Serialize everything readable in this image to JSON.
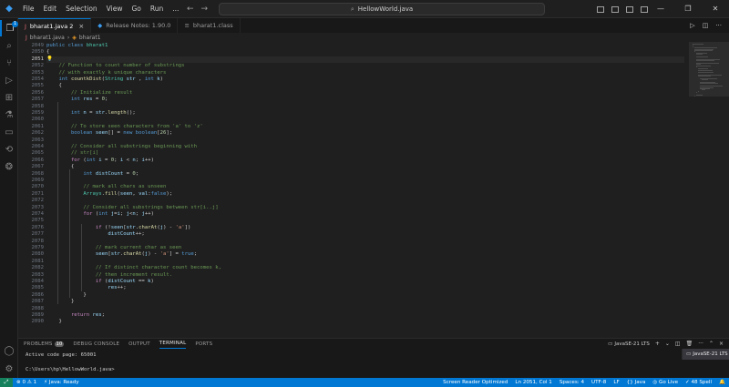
{
  "titlebar": {
    "menu": [
      "File",
      "Edit",
      "Selection",
      "View",
      "Go",
      "Run",
      "..."
    ],
    "search_text": "HellowWorld.java",
    "back_icon": "arrow-left-icon",
    "forward_icon": "arrow-right-icon"
  },
  "tabs": [
    {
      "label": "bharat1.java 2",
      "active": true
    },
    {
      "label": "Release Notes: 1.90.0",
      "active": false
    },
    {
      "label": "bharat1.class",
      "active": false
    }
  ],
  "breadcrumb": {
    "file": "bharat1.java",
    "symbol": "bharat1"
  },
  "editor": {
    "current_line": 2051,
    "lines": [
      {
        "n": 2049,
        "code": [
          [
            "kw",
            "public "
          ],
          [
            "kw",
            "class "
          ],
          [
            "ty",
            "bharat1"
          ]
        ]
      },
      {
        "n": 2050,
        "code": [
          [
            "",
            "{"
          ]
        ]
      },
      {
        "n": 2051,
        "code": [
          [
            "bulb",
            "💡"
          ]
        ]
      },
      {
        "n": 2052,
        "code": [
          [
            "cm",
            "    // Function to count number of substrings"
          ]
        ]
      },
      {
        "n": 2053,
        "code": [
          [
            "cm",
            "    // with exactly k unique characters"
          ]
        ]
      },
      {
        "n": 2054,
        "code": [
          [
            "kw",
            "    int "
          ],
          [
            "fn",
            "countkDist"
          ],
          [
            "",
            "("
          ],
          [
            "ty",
            "String "
          ],
          [
            "var",
            "str"
          ],
          [
            "",
            " , "
          ],
          [
            "kw",
            "int "
          ],
          [
            "var",
            "k"
          ],
          [
            "",
            ")"
          ]
        ]
      },
      {
        "n": 2055,
        "code": [
          [
            "",
            "    {"
          ]
        ]
      },
      {
        "n": 2056,
        "code": [
          [
            "cm",
            "        // Initialize result"
          ]
        ]
      },
      {
        "n": 2057,
        "code": [
          [
            "kw",
            "        int "
          ],
          [
            "var",
            "res"
          ],
          [
            "",
            " = "
          ],
          [
            "num",
            "0"
          ],
          [
            "",
            ";"
          ]
        ]
      },
      {
        "n": 2058,
        "code": [
          [
            "",
            ""
          ]
        ]
      },
      {
        "n": 2059,
        "code": [
          [
            "kw",
            "        int "
          ],
          [
            "var",
            "n"
          ],
          [
            "",
            " = "
          ],
          [
            "var",
            "str"
          ],
          [
            "",
            "."
          ],
          [
            "fn",
            "length"
          ],
          [
            "",
            "();"
          ]
        ]
      },
      {
        "n": 2060,
        "code": [
          [
            "",
            ""
          ]
        ]
      },
      {
        "n": 2061,
        "code": [
          [
            "cm",
            "        // To store seen characters from 'a' to 'z'"
          ]
        ]
      },
      {
        "n": 2062,
        "code": [
          [
            "kw",
            "        boolean "
          ],
          [
            "var",
            "seen"
          ],
          [
            "",
            "[] = "
          ],
          [
            "kw",
            "new "
          ],
          [
            "kw",
            "boolean"
          ],
          [
            "",
            "["
          ],
          [
            "num",
            "26"
          ],
          [
            "",
            "];"
          ]
        ]
      },
      {
        "n": 2063,
        "code": [
          [
            "",
            ""
          ]
        ]
      },
      {
        "n": 2064,
        "code": [
          [
            "cm",
            "        // Consider all substrings beginning with"
          ]
        ]
      },
      {
        "n": 2065,
        "code": [
          [
            "cm",
            "        // str[i]"
          ]
        ]
      },
      {
        "n": 2066,
        "code": [
          [
            "kw2",
            "        for "
          ],
          [
            "",
            "("
          ],
          [
            "kw",
            "int "
          ],
          [
            "var",
            "i"
          ],
          [
            "",
            " = "
          ],
          [
            "num",
            "0"
          ],
          [
            "",
            "; "
          ],
          [
            "var",
            "i"
          ],
          [
            "",
            " < "
          ],
          [
            "var",
            "n"
          ],
          [
            "",
            "; "
          ],
          [
            "var",
            "i"
          ],
          [
            "",
            "++)"
          ]
        ]
      },
      {
        "n": 2067,
        "code": [
          [
            "",
            "        {"
          ]
        ]
      },
      {
        "n": 2068,
        "code": [
          [
            "kw",
            "            int "
          ],
          [
            "var",
            "distCount"
          ],
          [
            "",
            " = "
          ],
          [
            "num",
            "0"
          ],
          [
            "",
            ";"
          ]
        ]
      },
      {
        "n": 2069,
        "code": [
          [
            "",
            ""
          ]
        ]
      },
      {
        "n": 2070,
        "code": [
          [
            "cm",
            "            // mark all chars as unseen"
          ]
        ]
      },
      {
        "n": 2071,
        "code": [
          [
            "ty",
            "            Arrays"
          ],
          [
            "",
            "."
          ],
          [
            "fn",
            "fill"
          ],
          [
            "",
            "("
          ],
          [
            "var",
            "seen"
          ],
          [
            "",
            ", "
          ],
          [
            "var",
            "val"
          ],
          [
            "",
            ":"
          ],
          [
            "kw",
            "false"
          ],
          [
            "",
            ");"
          ]
        ]
      },
      {
        "n": 2072,
        "code": [
          [
            "",
            ""
          ]
        ]
      },
      {
        "n": 2073,
        "code": [
          [
            "cm",
            "            // Consider all substrings between str[i..j]"
          ]
        ]
      },
      {
        "n": 2074,
        "code": [
          [
            "kw2",
            "            for "
          ],
          [
            "",
            "("
          ],
          [
            "kw",
            "int "
          ],
          [
            "var",
            "j"
          ],
          [
            "",
            "="
          ],
          [
            "var",
            "i"
          ],
          [
            "",
            "; "
          ],
          [
            "var",
            "j"
          ],
          [
            "",
            "<"
          ],
          [
            "var",
            "n"
          ],
          [
            "",
            "; "
          ],
          [
            "var",
            "j"
          ],
          [
            "",
            "++)"
          ]
        ]
      },
      {
        "n": 2075,
        "code": [
          [
            "",
            ""
          ]
        ]
      },
      {
        "n": 2076,
        "code": [
          [
            "kw2",
            "                if "
          ],
          [
            "",
            "(!"
          ],
          [
            "var",
            "seen"
          ],
          [
            "",
            "["
          ],
          [
            "var",
            "str"
          ],
          [
            "",
            "."
          ],
          [
            "fn",
            "charAt"
          ],
          [
            "",
            "("
          ],
          [
            "var",
            "j"
          ],
          [
            "",
            ") - "
          ],
          [
            "str",
            "'a'"
          ],
          [
            "",
            "])"
          ]
        ]
      },
      {
        "n": 2077,
        "code": [
          [
            "var",
            "                    distCount"
          ],
          [
            "",
            "++;"
          ]
        ]
      },
      {
        "n": 2078,
        "code": [
          [
            "",
            ""
          ]
        ]
      },
      {
        "n": 2079,
        "code": [
          [
            "cm",
            "                // mark current char as seen"
          ]
        ]
      },
      {
        "n": 2080,
        "code": [
          [
            "var",
            "                seen"
          ],
          [
            "",
            "["
          ],
          [
            "var",
            "str"
          ],
          [
            "",
            "."
          ],
          [
            "fn",
            "charAt"
          ],
          [
            "",
            "("
          ],
          [
            "var",
            "j"
          ],
          [
            "",
            ") - "
          ],
          [
            "str",
            "'a'"
          ],
          [
            "",
            "] = "
          ],
          [
            "kw",
            "true"
          ],
          [
            "",
            ";"
          ]
        ]
      },
      {
        "n": 2081,
        "code": [
          [
            "",
            ""
          ]
        ]
      },
      {
        "n": 2082,
        "code": [
          [
            "cm",
            "                // If distinct character count becomes k,"
          ]
        ]
      },
      {
        "n": 2083,
        "code": [
          [
            "cm",
            "                // then increment result."
          ]
        ]
      },
      {
        "n": 2084,
        "code": [
          [
            "kw2",
            "                if "
          ],
          [
            "",
            "("
          ],
          [
            "var",
            "distCount"
          ],
          [
            "",
            " == "
          ],
          [
            "var",
            "k"
          ],
          [
            "",
            ")"
          ]
        ]
      },
      {
        "n": 2085,
        "code": [
          [
            "var",
            "                    res"
          ],
          [
            "",
            "++;"
          ]
        ]
      },
      {
        "n": 2086,
        "code": [
          [
            "",
            "            }"
          ]
        ]
      },
      {
        "n": 2087,
        "code": [
          [
            "",
            "        }"
          ]
        ]
      },
      {
        "n": 2088,
        "code": [
          [
            "",
            ""
          ]
        ]
      },
      {
        "n": 2089,
        "code": [
          [
            "kw2",
            "        return "
          ],
          [
            "var",
            "res"
          ],
          [
            "",
            ";"
          ]
        ]
      },
      {
        "n": 2090,
        "code": [
          [
            "",
            "    }"
          ]
        ]
      }
    ]
  },
  "panel": {
    "tabs": [
      {
        "label": "PROBLEMS",
        "badge": "10"
      },
      {
        "label": "DEBUG CONSOLE",
        "badge": ""
      },
      {
        "label": "OUTPUT",
        "badge": ""
      },
      {
        "label": "TERMINAL",
        "badge": "",
        "active": true
      },
      {
        "label": "PORTS",
        "badge": ""
      }
    ],
    "terminal_name": "JavaSE-21 LTS",
    "terminal_list_item": "JavaSE-21 LTS",
    "terminal_lines": [
      "Active code page: 65001",
      "",
      "C:\\Users\\hp\\HellowWorld.java>"
    ]
  },
  "statusbar": {
    "left": [
      "⊗ 0 ⚠ 1",
      "⚡ Java: Ready"
    ],
    "right": [
      "Screen Reader Optimized",
      "Ln 2051, Col 1",
      "Spaces: 4",
      "UTF-8",
      "LF",
      "{} Java",
      "◎ Go Live",
      "✓ 48 Spell"
    ]
  },
  "colors": {
    "accent": "#0078d4",
    "editor_bg": "#1f1f1f",
    "statusbar": "#0078d4"
  }
}
